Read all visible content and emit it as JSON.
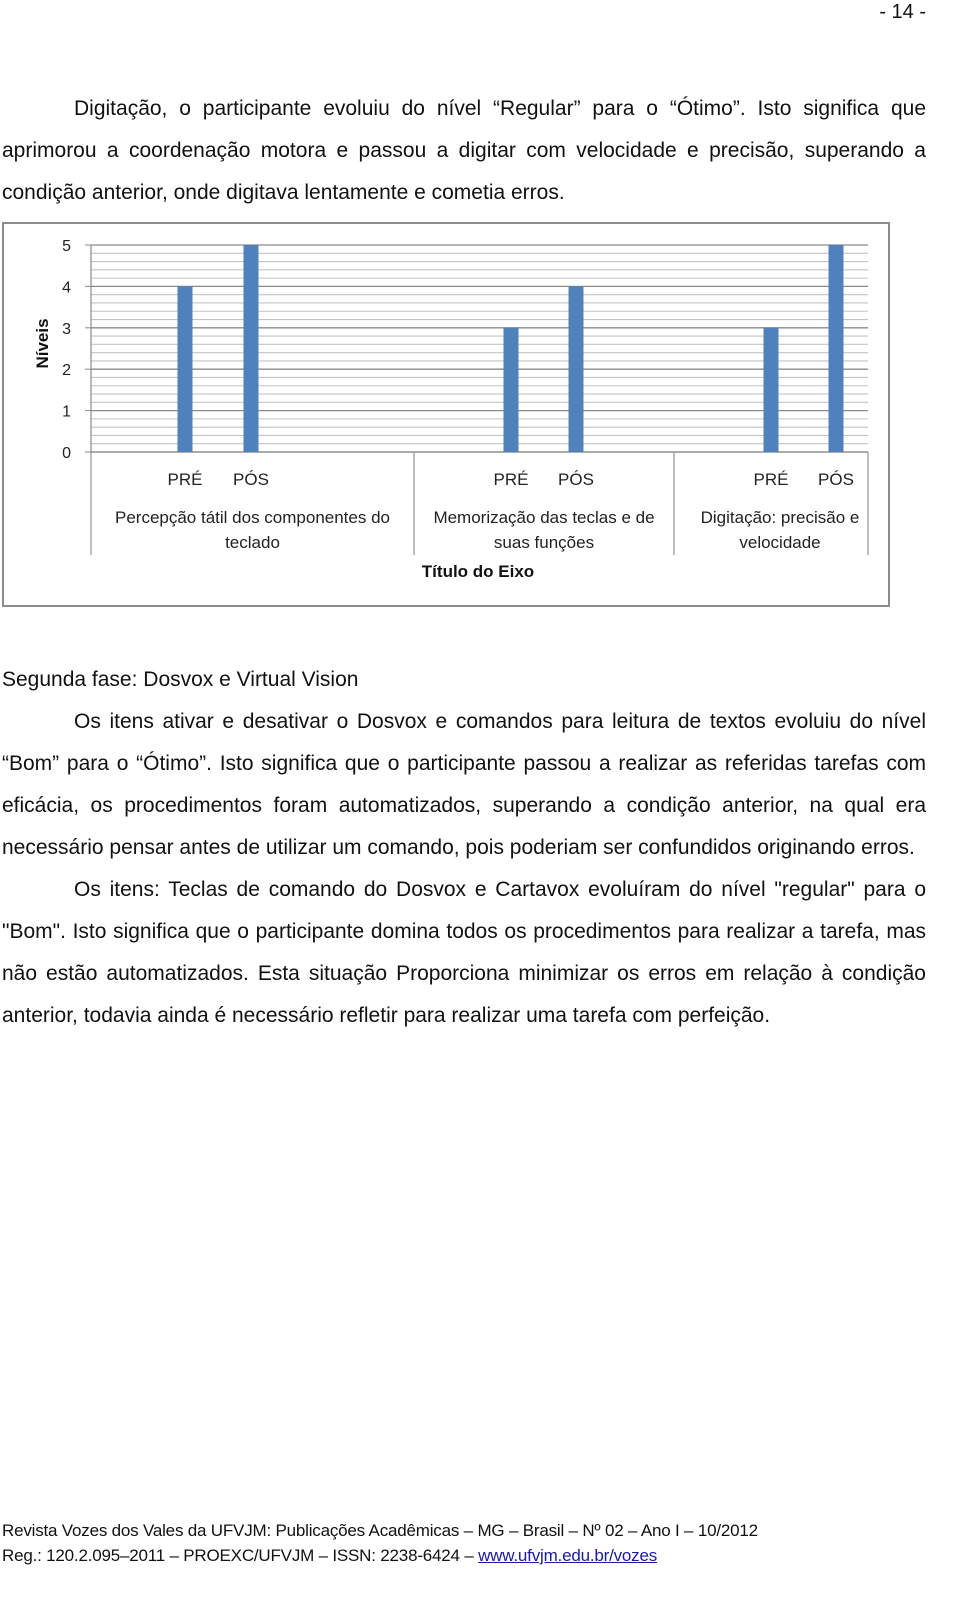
{
  "page": {
    "number_label": "- 14 -"
  },
  "paragraphs": {
    "intro": "Digitação, o participante evoluiu do nível “Regular” para o “Ótimo”. Isto significa que aprimorou a coordenação motora e passou a digitar com velocidade e precisão, superando a condição anterior, onde digitava lentamente e cometia erros.",
    "section_heading": "Segunda fase: Dosvox e Virtual Vision",
    "p2": "Os itens ativar e desativar o Dosvox e comandos para leitura de textos evoluiu do nível “Bom” para o “Ótimo”. Isto significa que o participante passou a realizar as referidas tarefas com eficácia, os procedimentos foram automatizados, superando a condição anterior, na qual era necessário pensar antes de utilizar um comando, pois poderiam ser confundidos originando erros.",
    "p3": "Os itens: Teclas de comando do Dosvox e Cartavox evoluíram do nível \"regular\" para o \"Bom\". Isto significa que o participante domina todos os procedimentos para realizar a tarefa, mas não estão automatizados.  Esta situação Proporciona minimizar os erros em relação à condição anterior, todavia ainda é necessário refletir para realizar uma tarefa com perfeição."
  },
  "footer": {
    "line1": "Revista Vozes dos Vales da UFVJM: Publicações Acadêmicas – MG – Brasil – Nº 02 – Ano I – 10/2012",
    "line2_prefix": "Reg.: 120.2.095–2011 – PROEXC/UFVJM – ISSN: 2238-6424 – ",
    "link_text": "www.ufvjm.edu.br/vozes"
  },
  "chart_data": {
    "type": "bar",
    "title": "",
    "xlabel": "Título do Eixo",
    "ylabel": "Níveis",
    "ylim": [
      0,
      5
    ],
    "yticks": [
      0,
      1,
      2,
      3,
      4,
      5
    ],
    "minor_grid_step": 0.2,
    "grid": true,
    "bar_color": "#4f81bd",
    "groups": [
      {
        "label": "Percepção tátil dos componentes do teclado",
        "label_lines": [
          "Percepção tátil dos componentes do",
          "teclado"
        ],
        "categories": [
          "PRÉ",
          "PÓS"
        ],
        "values": [
          4,
          5
        ]
      },
      {
        "label": "Memorização das teclas e de suas funções",
        "label_lines": [
          "Memorização das teclas e de",
          "suas funções"
        ],
        "categories": [
          "PRÉ",
          "PÓS"
        ],
        "values": [
          3,
          4
        ]
      },
      {
        "label": "Digitação: precisão e velocidade",
        "label_lines": [
          "Digitação: precisão e",
          "velocidade"
        ],
        "categories": [
          "PRÉ",
          "PÓS"
        ],
        "values": [
          3,
          5
        ]
      }
    ]
  }
}
